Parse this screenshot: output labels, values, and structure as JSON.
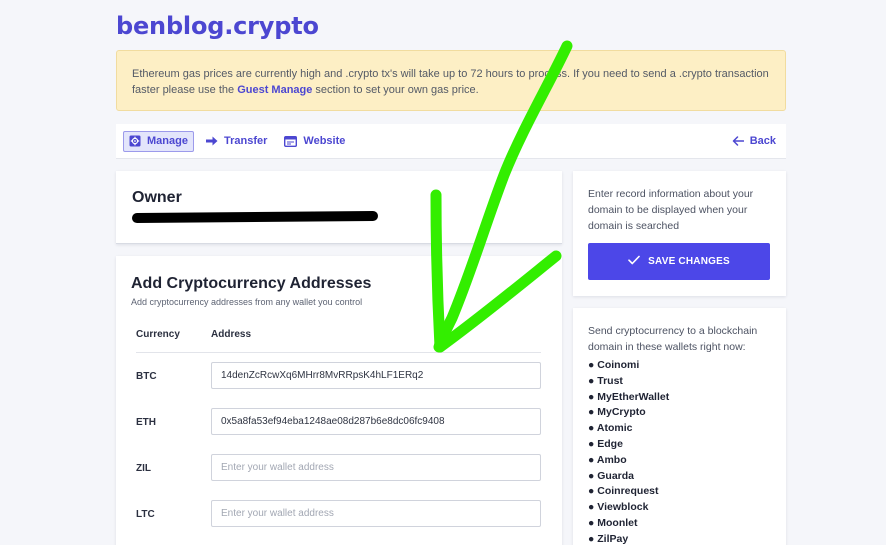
{
  "site": {
    "title": "benblog.crypto"
  },
  "banner": {
    "text_before": "Ethereum gas prices are currently high and .crypto tx's will take up to 72 hours to process. If you need to send a .crypto transaction faster please use the ",
    "link_text": "Guest Manage",
    "text_after": " section to set your own gas price."
  },
  "nav": {
    "manage": "Manage",
    "transfer": "Transfer",
    "website": "Website",
    "back": "Back",
    "active": "Manage"
  },
  "owner": {
    "title": "Owner"
  },
  "addresses": {
    "title": "Add Cryptocurrency Addresses",
    "subtitle": "Add cryptocurrency addresses from any wallet you control",
    "col_currency": "Currency",
    "col_address": "Address",
    "rows": [
      {
        "currency": "BTC",
        "value": "14denZcRcwXq6MHrr8MvRRpsK4hLF1ERq2",
        "placeholder": "Enter your wallet address"
      },
      {
        "currency": "ETH",
        "value": "0x5a8fa53ef94eba1248ae08d287b6e8dc06fc9408",
        "placeholder": "Enter your wallet address"
      },
      {
        "currency": "ZIL",
        "value": "",
        "placeholder": "Enter your wallet address"
      },
      {
        "currency": "LTC",
        "value": "",
        "placeholder": "Enter your wallet address"
      }
    ]
  },
  "save_panel": {
    "description": "Enter record information about your domain to be displayed when your domain is searched",
    "button_label": "SAVE CHANGES"
  },
  "wallets_panel": {
    "intro": "Send cryptocurrency to a blockchain domain in these wallets right now:",
    "items": [
      "Coinomi",
      "Trust",
      "MyEtherWallet",
      "MyCrypto",
      "Atomic",
      "Edge",
      "Ambo",
      "Guarda",
      "Coinrequest",
      "Viewblock",
      "Moonlet",
      "ZilPay"
    ]
  },
  "colors": {
    "accent": "#4c47d1",
    "button": "#4c47e8",
    "banner_bg": "#fdefc5",
    "annotation_arrow": "#33ee00",
    "redaction": "#000000"
  },
  "icons": {
    "manage": "settings-square-icon",
    "transfer": "arrow-right-icon",
    "website": "browser-window-icon",
    "back": "arrow-left-icon",
    "save": "checkmark-icon"
  }
}
